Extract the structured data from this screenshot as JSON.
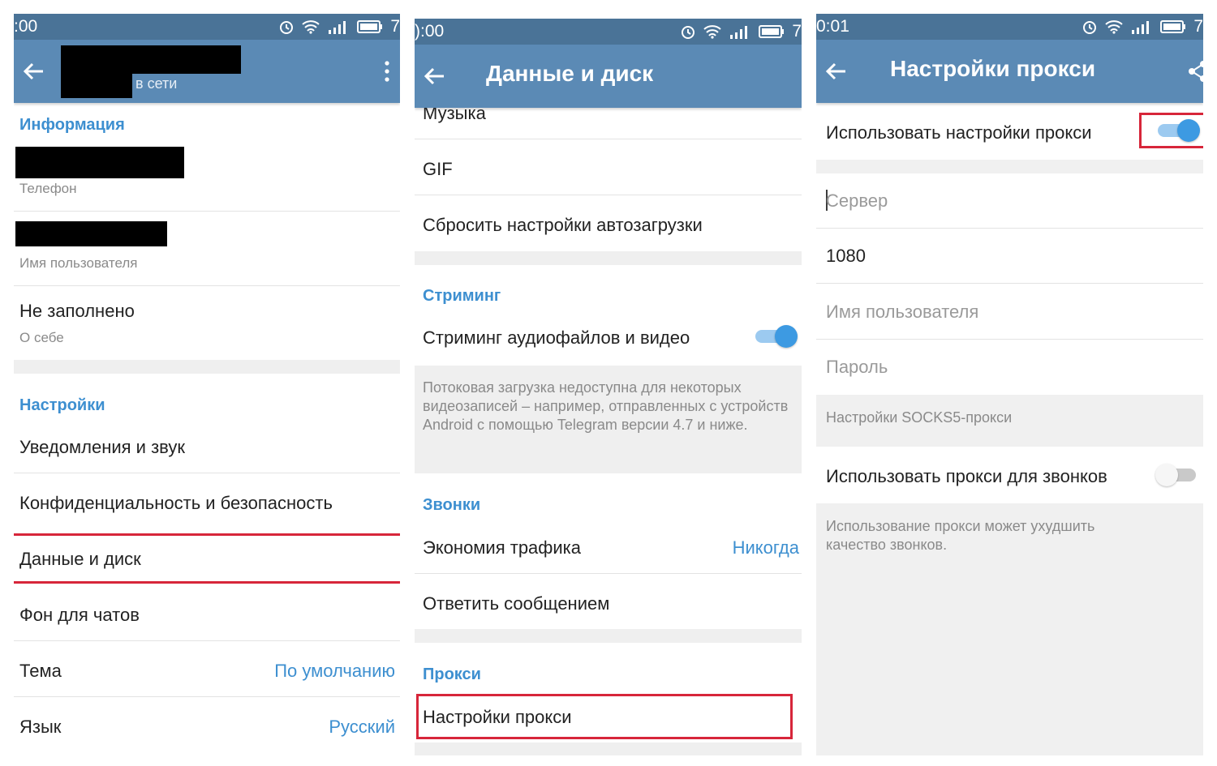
{
  "screen1": {
    "status_time": ":00",
    "status_battery": "7",
    "profile_status": "в сети",
    "section_info": "Информация",
    "phone_caption": "Телефон",
    "username_caption": "Имя пользователя",
    "bio_value": "Не заполнено",
    "bio_caption": "О себе",
    "section_settings": "Настройки",
    "items": {
      "notifications": "Уведомления и звук",
      "privacy": "Конфиденциальность и безопасность",
      "data": "Данные и диск",
      "wallpaper": "Фон для чатов",
      "theme": "Тема",
      "theme_value": "По умолчанию",
      "language": "Язык",
      "language_value": "Русский"
    }
  },
  "screen2": {
    "status_time": "):00",
    "status_battery": "7",
    "title": "Данные и диск",
    "music": "Музыка",
    "gif": "GIF",
    "reset_autodownload": "Сбросить настройки автозагрузки",
    "section_streaming": "Стриминг",
    "streaming_label": "Стриминг аудиофайлов и видео",
    "streaming_on": true,
    "streaming_note": "Потоковая загрузка недоступна для некоторых видеозаписей – например, отправленных с устройств Android с помощью Telegram версии 4.7 и ниже.",
    "section_calls": "Звонки",
    "traffic_saving": "Экономия трафика",
    "traffic_saving_value": "Никогда",
    "reply_with_message": "Ответить сообщением",
    "section_proxy": "Прокси",
    "proxy_settings": "Настройки прокси"
  },
  "screen3": {
    "status_time": "0:01",
    "status_battery": "7",
    "title": "Настройки прокси",
    "use_proxy": "Использовать настройки прокси",
    "use_proxy_on": true,
    "server_placeholder": "Сервер",
    "port_value": "1080",
    "username_placeholder": "Имя пользователя",
    "password_placeholder": "Пароль",
    "socks5_note": "Настройки SOCKS5-прокси",
    "use_proxy_calls": "Использовать прокси для звонков",
    "use_proxy_calls_on": false,
    "calls_note": "Использование прокси может ухудшить качество звонков."
  },
  "colors": {
    "statusbar": "#4a7397",
    "appbar": "#5b8ab5",
    "accent": "#3d8fd0",
    "highlight": "#d7263a"
  }
}
